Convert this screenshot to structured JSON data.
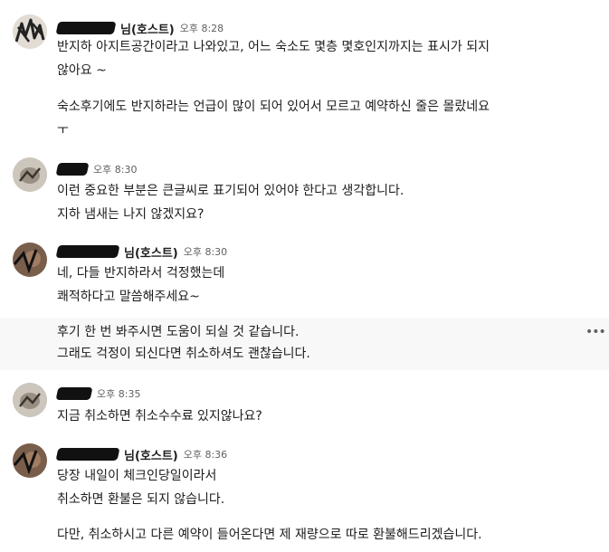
{
  "messages": [
    {
      "host_label": "님(호스트)",
      "time": "오후 8:28",
      "lines": [
        "반지하 아지트공간이라고 나와있고, 어느 숙소도 몇층 몇호인지까지는 표시가 되지",
        "않아요 ~",
        "숙소후기에도 반지하라는 언급이 많이 되어 있어서 모르고 예약하신 줄은 몰랐네요",
        "ㅜ"
      ]
    },
    {
      "host_label": "",
      "time": "오후 8:30",
      "lines": [
        "이런 중요한 부분은 큰글씨로 표기되어 있어야 한다고 생각합니다.",
        "지하 냄새는 나지 않겠지요?"
      ]
    },
    {
      "host_label": "님(호스트)",
      "time": "오후 8:30",
      "lines": [
        "네, 다들 반지하라서 걱정했는데",
        "쾌적하다고 말씀해주세요~",
        "후기 한 번 봐주시면 도움이 되실 것 같습니다.",
        "그래도 걱정이 되신다면 취소하셔도 괜찮습니다."
      ]
    },
    {
      "host_label": "",
      "time": "오후 8:35",
      "lines": [
        "지금 취소하면 취소수수료 있지않나요?"
      ]
    },
    {
      "host_label": "님(호스트)",
      "time": "오후 8:36",
      "lines": [
        "당장 내일이 체크인당일이라서",
        "취소하면 환불은 되지 않습니다.",
        "다만, 취소하시고 다른 예약이 들어온다면 제 재량으로 따로 환불해드리겠습니다."
      ]
    }
  ],
  "more_actions_icon": "more-horizontal-icon",
  "more_actions_glyph": "•••"
}
